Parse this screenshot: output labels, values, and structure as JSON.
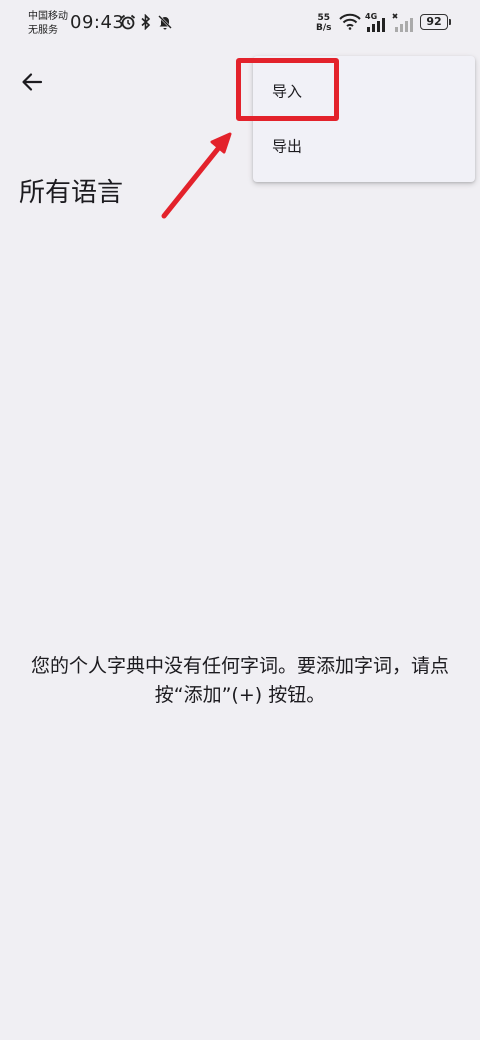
{
  "status_bar": {
    "carrier_line1": "中国移动",
    "carrier_line2": "无服务",
    "time": "09:43",
    "net_speed_value": "55",
    "net_speed_unit": "B/s",
    "signal_label": "4G",
    "battery": "92",
    "icons": [
      "alarm-icon",
      "bluetooth-icon",
      "mute-icon",
      "wifi-icon",
      "cellular-signal-icon",
      "no-signal-icon",
      "battery-icon"
    ]
  },
  "app_bar": {
    "back_icon": "arrow-left-icon",
    "title": "所有语言"
  },
  "menu": {
    "items": [
      {
        "label": "导入"
      },
      {
        "label": "导出"
      }
    ]
  },
  "empty_state": {
    "message": "您的个人字典中没有任何字词。要添加字词，请点按“添加”(+) 按钮。"
  },
  "annotation": {
    "color": "#e3222b"
  }
}
